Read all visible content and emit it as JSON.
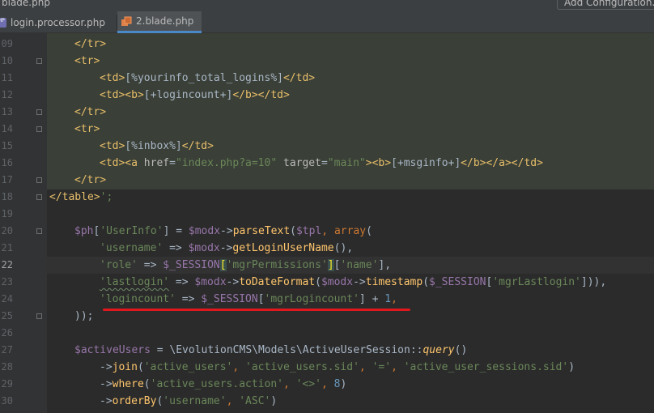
{
  "window": {
    "title": "blade.php",
    "config_button": "Add Configuration..."
  },
  "tabs": [
    {
      "label": "login.processor.php",
      "icon": "php-file-icon",
      "active": false
    },
    {
      "label": "2.blade.php",
      "icon": "blade-file-icon",
      "active": true
    }
  ],
  "gutter": {
    "line_numbers": [
      "09",
      "10",
      "11",
      "12",
      "13",
      "14",
      "15",
      "16",
      "17",
      "18",
      "19",
      "20",
      "21",
      "22",
      "23",
      "24",
      "25",
      "26",
      "27",
      "28",
      "29",
      "30"
    ],
    "current_line": "22"
  },
  "code": {
    "l09": [
      "</tr>"
    ],
    "l10": [
      "<tr>"
    ],
    "l11": [
      "<td>",
      "[%yourinfo_total_logins%]",
      "</td>"
    ],
    "l12": [
      "<td><b>",
      "[+logincount+]",
      "</b></td>"
    ],
    "l13": [
      "</tr>"
    ],
    "l14": [
      "<tr>"
    ],
    "l15": [
      "<td>",
      "[%inbox%]",
      "</td>"
    ],
    "l16": [
      "<td><a ",
      "href",
      "=",
      "\"index.php?a=10\"",
      " ",
      "target",
      "=",
      "\"main\"",
      "><b>",
      "[+msginfo+]",
      "</b></a></td>"
    ],
    "l17": [
      "</tr>"
    ],
    "l18": [
      "</table>",
      "';"
    ],
    "l20": [
      "$ph",
      "[",
      "'UserInfo'",
      "] = ",
      "$modx",
      "->",
      "parseText",
      "(",
      "$tpl",
      ", ",
      "array",
      "("
    ],
    "l21": [
      "'username'",
      " => ",
      "$modx",
      "->",
      "getLoginUserName",
      "(),"
    ],
    "l22": [
      "'role'",
      " => ",
      "$_SESSION",
      "[",
      "'mgrPermissions'",
      "]",
      "[",
      "'name'",
      "],"
    ],
    "l23": [
      "'lastlogin'",
      " => ",
      "$modx",
      "->",
      "toDateFormat",
      "(",
      "$modx",
      "->",
      "timestamp",
      "(",
      "$_SESSION",
      "[",
      "'mgrLastlogin'",
      "])),"
    ],
    "l24": [
      "'logincount'",
      " => ",
      "$_SESSION",
      "[",
      "'mgrLogincount'",
      "] + ",
      "1",
      ","
    ],
    "l25": [
      "));"
    ],
    "l27": [
      "$activeUsers",
      " = \\EvolutionCMS\\Models\\",
      "ActiveUserSession",
      "::",
      "query",
      "()"
    ],
    "l28": [
      "->",
      "join",
      "(",
      "'active_users'",
      ", ",
      "'active_users.sid'",
      ", ",
      "'='",
      ", ",
      "'active_user_sessions.sid'",
      ")"
    ],
    "l29": [
      "->",
      "where",
      "(",
      "'active_users.action'",
      ", ",
      "'<>'",
      ", ",
      "8",
      ")"
    ],
    "l30": [
      "->",
      "orderBy",
      "(",
      "'username'",
      ", ",
      "'ASC'",
      ")"
    ]
  },
  "colors": {
    "background": "#2b2b2b",
    "tag": "#e8bf6a",
    "string": "#6a8759",
    "keyword": "#cc7832",
    "variable": "#9876aa",
    "function": "#ffc66d",
    "annotation_underline": "#e0181e"
  }
}
